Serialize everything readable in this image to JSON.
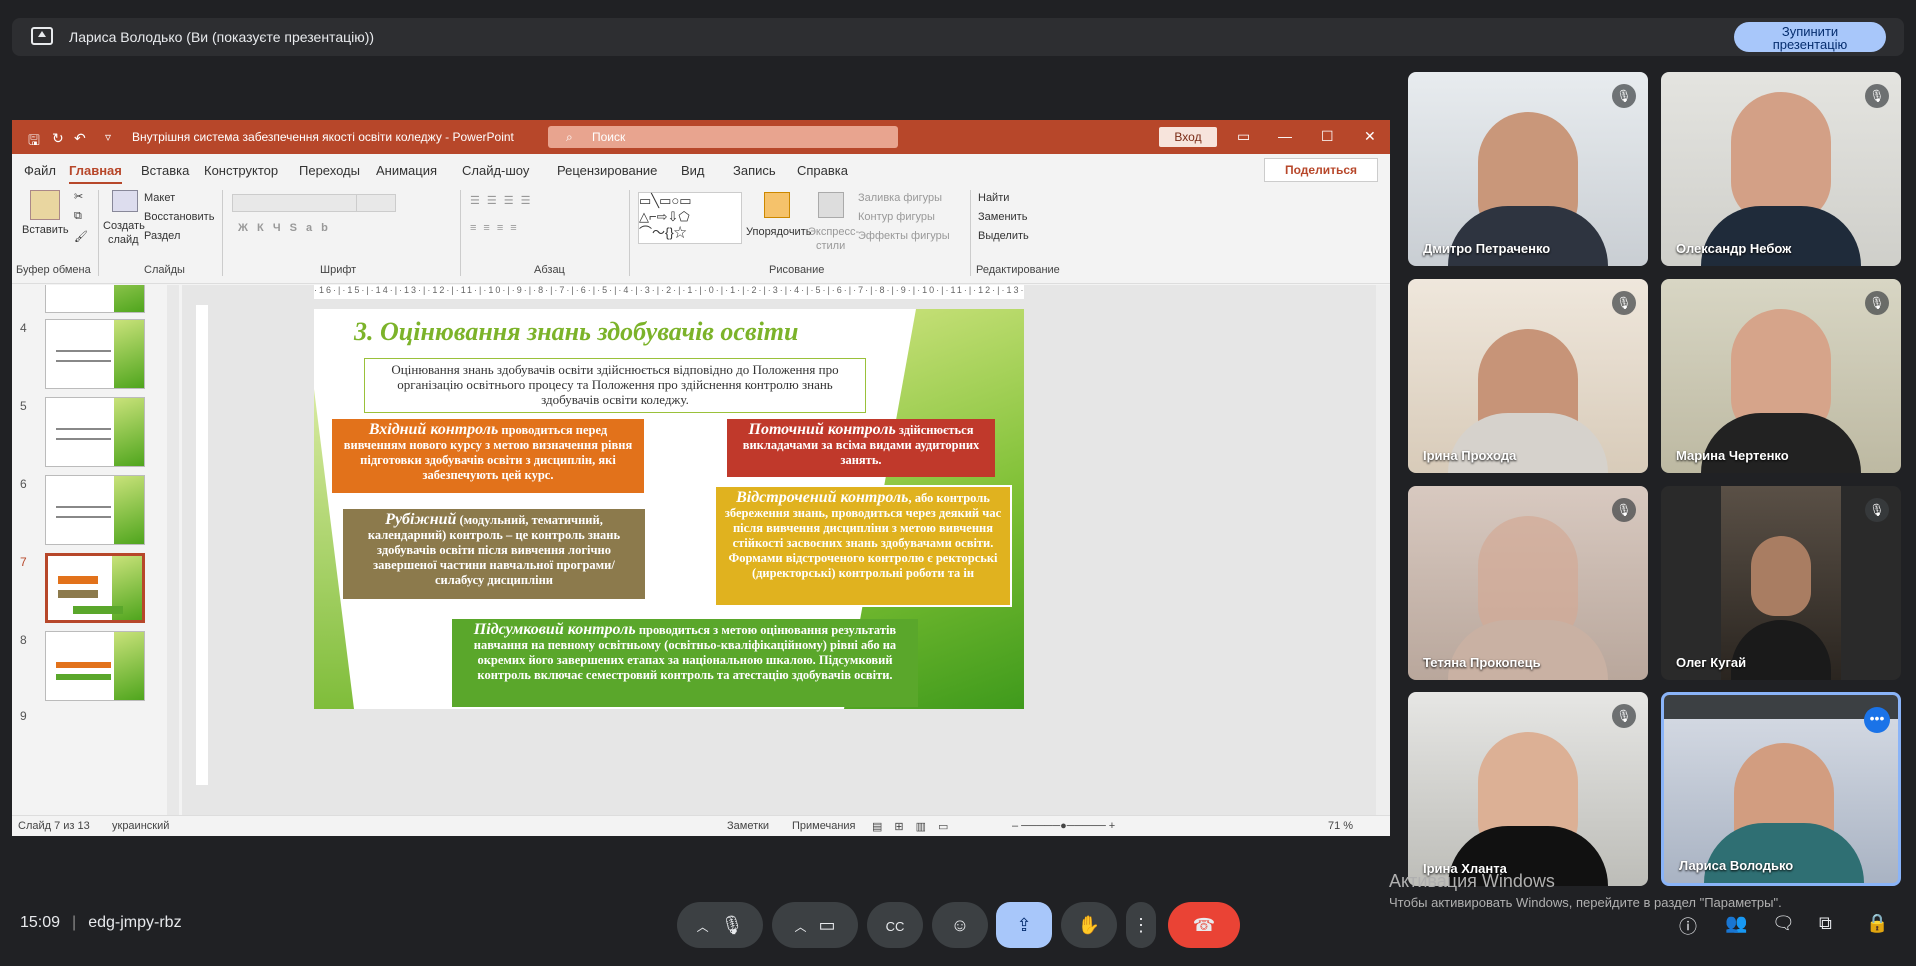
{
  "share": {
    "title": "Лариса Володько (Ви (показуєте презентацію))",
    "stop_label_1": "Зупинити",
    "stop_label_2": "презентацію"
  },
  "ppt": {
    "doc_title": "Внутрішня система забезпечення якості освіти коледжу  -  PowerPoint",
    "search_placeholder": "Поиск",
    "login": "Вход",
    "menus": [
      "Файл",
      "Главная",
      "Вставка",
      "Конструктор",
      "Переходы",
      "Анимация",
      "Слайд-шоу",
      "Рецензирование",
      "Вид",
      "Запись",
      "Справка"
    ],
    "share": "Поделиться",
    "ribbon": {
      "paste": "Вставить",
      "create_slide_1": "Создать",
      "create_slide_2": "слайд",
      "layout": "Макет",
      "restore": "Восстановить",
      "section": "Раздел",
      "shapes_arrange": "Упорядочить",
      "quick_styles_1": "Экспресс-",
      "quick_styles_2": "стили",
      "shape_fill": "Заливка фигуры",
      "shape_outline": "Контур фигуры",
      "shape_effects": "Эффекты фигуры",
      "find": "Найти",
      "replace": "Заменить",
      "select": "Выделить",
      "groups": [
        "Буфер обмена",
        "Слайды",
        "Шрифт",
        "Абзац",
        "Рисование",
        "Редактирование"
      ]
    },
    "thumb_numbers": [
      "4",
      "5",
      "6",
      "7",
      "8",
      "9"
    ],
    "ruler": "·16·|·15·|·14·|·13·|·12·|·11·|·10·|·9·|·8·|·7·|·6·|·5·|·4·|·3·|·2·|·1·|·0·|·1·|·2·|·3·|·4·|·5·|·6·|·7·|·8·|·9·|·10·|·11·|·12·|·13·|·14·|·15·|·16·",
    "slide": {
      "title": "3. Оцінювання знань здобувачів освіти",
      "intro": "Оцінювання знань здобувачів освіти здійснюється відповідно до Положення про організацію освітнього процесу та Положення про здійснення контролю знань здобувачів освіти коледжу.",
      "b1_head": "Вхідний контроль",
      "b1_text": " проводиться перед вивченням нового курсу з метою визначення рівня підготовки здобувачів освіти з дисциплін, які забезпечують цей курс.",
      "b2_head": "Поточний контроль",
      "b2_text": " здійснюється викладачами за всіма видами аудиторних занять.",
      "b3_head": "Рубіжний",
      "b3_text": " (модульний, тематичний, календарний) контроль – це контроль знань здобувачів освіти після вивчення логічно завершеної частини навчальної програми/силабусу дисципліни",
      "b4_head": "Відстрочений контроль",
      "b4_text": ", або контроль збереження знань, проводиться через деякий час після вивчення дисципліни з метою вивчення стійкості засвоєних знань здобувачами освіти. Формами відстроченого контролю є ректорські (директорські) контрольні роботи та ін",
      "b5_head": "Підсумковий контроль",
      "b5_text": " проводиться з метою оцінювання результатів навчання на певному освітньому (освітньо-кваліфікаційному) рівні або на окремих його завершених етапах за національною шкалою. Підсумковий контроль включає семестровий контроль та атестацію здобувачів освіти."
    },
    "status": {
      "slide": "Слайд 7 из 13",
      "lang": "украинский",
      "notes": "Заметки",
      "comments": "Примечания",
      "zoom": "71 %"
    }
  },
  "participants": [
    {
      "name": "Дмитро Петраченко",
      "muted": true
    },
    {
      "name": "Олександр Небож",
      "muted": true
    },
    {
      "name": "Ірина Прохода",
      "muted": true
    },
    {
      "name": "Марина Чертенко",
      "muted": true
    },
    {
      "name": "Тетяна Прокопець",
      "muted": true
    },
    {
      "name": "Олег Кугай",
      "muted": true
    },
    {
      "name": "Ірина Хланта",
      "muted": true
    },
    {
      "name": "Лариса Володько",
      "muted": false
    }
  ],
  "meeting": {
    "time": "15:09",
    "code": "edg-jmpy-rbz"
  },
  "windows": {
    "activation": "Активация Windows",
    "hint": "Чтобы активировать Windows, перейдите в раздел \"Параметры\"."
  },
  "colors": {
    "ppt_red": "#b7472a",
    "meet_bg": "#202124",
    "accent": "#a8c7fa",
    "end_call": "#ea4335"
  }
}
